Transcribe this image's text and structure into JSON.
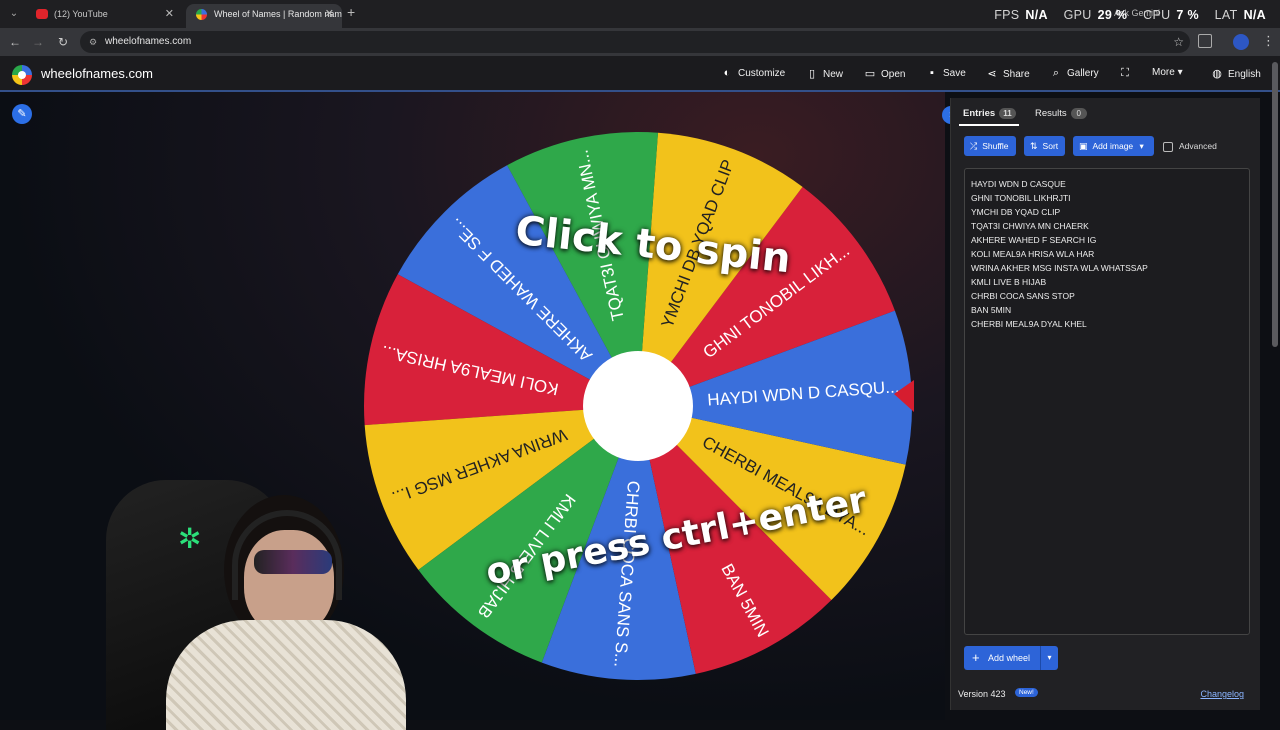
{
  "browser": {
    "tabs": [
      {
        "title": "(12) YouTube",
        "active": false
      },
      {
        "title": "Wheel of Names | Random nam",
        "active": true
      }
    ],
    "url": "wheelofnames.com"
  },
  "overlay": {
    "fps_label": "FPS",
    "fps_value": "N/A",
    "gpu_label": "GPU",
    "gpu_value": "29 %",
    "cpu_label": "CPU",
    "cpu_value": "7 %",
    "lat_label": "LAT",
    "lat_value": "N/A",
    "ask_gemini": "Ask Gemini"
  },
  "app": {
    "logo": "wheelofnames.com",
    "menu": {
      "customize": "Customize",
      "new": "New",
      "open": "Open",
      "save": "Save",
      "share": "Share",
      "gallery": "Gallery",
      "more": "More",
      "language": "English"
    }
  },
  "wheel": {
    "cta_line1": "Click to spin",
    "cta_line2": "or press ctrl+enter",
    "colors": {
      "blue": "#3a6fdb",
      "red": "#d8213a",
      "yellow": "#f2c21b",
      "green": "#2fa84a"
    },
    "segments": [
      {
        "label": "GHNI TONOBIL LIKH...",
        "color": "red"
      },
      {
        "label": "YMCHI DB YQAD CLIP",
        "color": "yellow"
      },
      {
        "label": "TQAT3I CHWIYA MN...",
        "color": "green"
      },
      {
        "label": "AKHERE WAHED F SE...",
        "color": "blue"
      },
      {
        "label": "KOLI MEAL9A HRISA...",
        "color": "red"
      },
      {
        "label": "WRINA AKHER MSG I...",
        "color": "yellow"
      },
      {
        "label": "KMLI LIVE B HIJAB",
        "color": "green"
      },
      {
        "label": "CHRBI COCA SANS S...",
        "color": "blue"
      },
      {
        "label": "BAN 5MIN",
        "color": "red"
      },
      {
        "label": "CHERBI MEAL9A DYA...",
        "color": "yellow"
      },
      {
        "label": "HAYDI WDN D CASQU...",
        "color": "blue"
      }
    ]
  },
  "panel": {
    "entries_tab": "Entries",
    "entries_count": "11",
    "results_tab": "Results",
    "results_count": "0",
    "shuffle": "Shuffle",
    "sort": "Sort",
    "add_image": "Add image",
    "advanced": "Advanced",
    "entries": [
      "HAYDI WDN D CASQUE",
      "GHNI TONOBIL LIKHRJTI",
      "YMCHI DB YQAD CLIP",
      "TQAT3I CHWIYA MN CHAERK",
      "AKHERE WAHED F SEARCH IG",
      "KOLI MEAL9A HRISA WLA HAR",
      "WRINA AKHER MSG INSTA WLA WHATSSAP",
      "KMLI LIVE B HIJAB",
      "CHRBI COCA SANS STOP",
      "BAN 5MIN",
      "CHERBI MEAL9A DYAL KHEL"
    ],
    "add_wheel": "Add wheel",
    "version": "Version 423",
    "new_badge": "New!",
    "changelog": "Changelog"
  }
}
